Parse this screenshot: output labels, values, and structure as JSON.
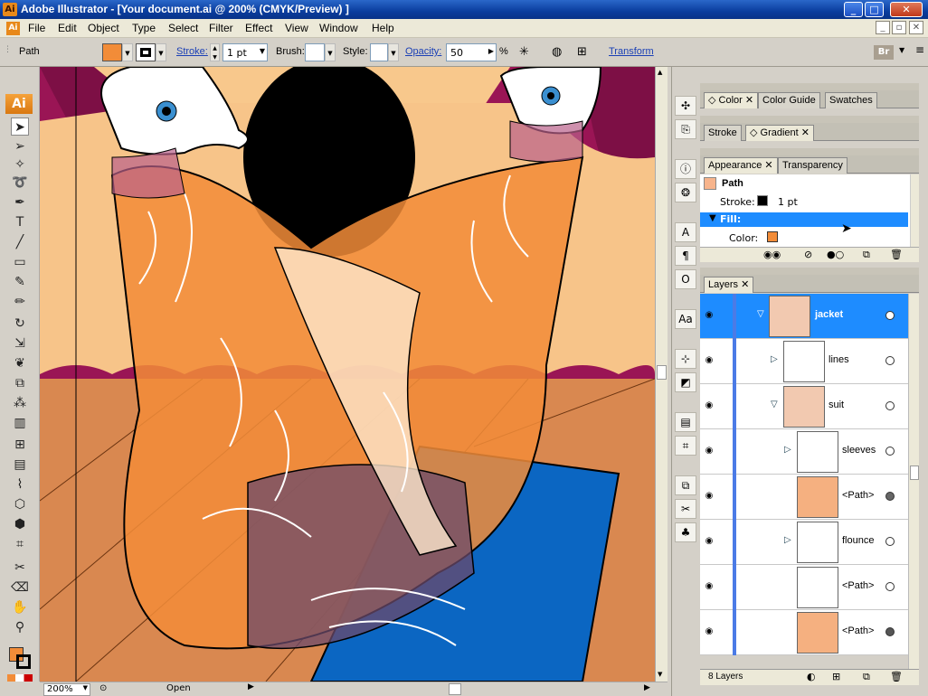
{
  "window": {
    "title": "Adobe Illustrator - [Your document.ai @ 200% (CMYK/Preview) ]",
    "app_icon": "Ai"
  },
  "menu": {
    "items": [
      "File",
      "Edit",
      "Object",
      "Type",
      "Select",
      "Filter",
      "Effect",
      "View",
      "Window",
      "Help"
    ]
  },
  "control": {
    "path_label": "Path",
    "stroke_label": "Stroke:",
    "stroke_value": "1 pt",
    "brush_label": "Brush:",
    "style_label": "Style:",
    "opacity_label": "Opacity:",
    "opacity_value": "50",
    "percent": "%",
    "transform_label": "Transform",
    "fill_color": "#f28c38",
    "stroke_color": "#000000",
    "br_label": "Br"
  },
  "toolbox": {
    "logo": "Ai"
  },
  "status": {
    "zoom": "200%",
    "info": "Open"
  },
  "panels": {
    "color_tabs": [
      "Color",
      "Color Guide",
      "Swatches"
    ],
    "stroke_tabs": [
      "Stroke",
      "Gradient"
    ],
    "appearance_tabs": [
      "Appearance",
      "Transparency"
    ],
    "appearance": {
      "path": "Path",
      "stroke_label": "Stroke:",
      "stroke_value": "1 pt",
      "fill_label": "Fill:",
      "color_label": "Color:"
    },
    "layers_tab": "Layers",
    "layers": [
      {
        "name": "jacket",
        "selected": true
      },
      {
        "name": "lines"
      },
      {
        "name": "suit"
      },
      {
        "name": "sleeves"
      },
      {
        "name": "<Path>"
      },
      {
        "name": "flounce"
      },
      {
        "name": "<Path>"
      },
      {
        "name": "<Path>"
      }
    ],
    "layers_count": "8 Layers"
  },
  "colors": {
    "title_bar": "#0a3d9e",
    "selection": "#1e8cff",
    "accent": "#f28c38",
    "stage_red": "#9a1555",
    "suit": "#f28c38",
    "table": "#0b66c2"
  }
}
